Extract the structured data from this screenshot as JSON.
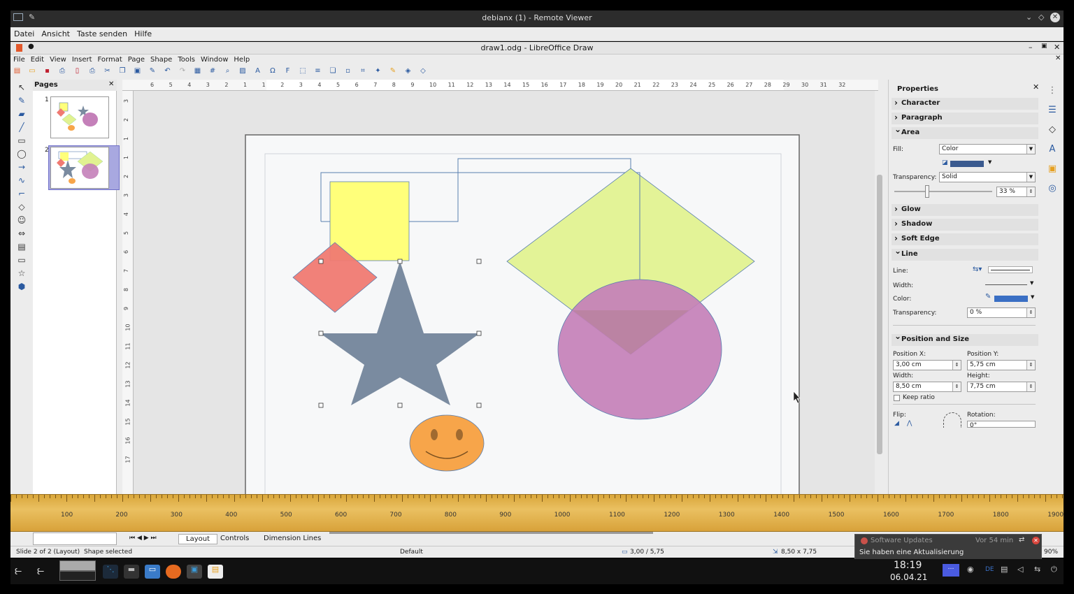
{
  "remote_viewer": {
    "title": "debianx (1) - Remote Viewer",
    "menu": [
      "Datei",
      "Ansicht",
      "Taste senden",
      "Hilfe"
    ]
  },
  "lo": {
    "title": "draw1.odg - LibreOffice Draw",
    "menu": [
      "File",
      "Edit",
      "View",
      "Insert",
      "Format",
      "Page",
      "Shape",
      "Tools",
      "Window",
      "Help"
    ]
  },
  "pages_pane": {
    "title": "Pages",
    "pages": [
      "1",
      "2"
    ],
    "selected": 1
  },
  "hruler_ticks": [
    "6",
    "5",
    "4",
    "3",
    "2",
    "1",
    "1",
    "2",
    "3",
    "4",
    "5",
    "6",
    "7",
    "8",
    "9",
    "10",
    "11",
    "12",
    "13",
    "14",
    "15",
    "16",
    "17",
    "18",
    "19",
    "20",
    "21",
    "22",
    "23",
    "24",
    "25",
    "26",
    "27",
    "28",
    "29",
    "30",
    "31",
    "32"
  ],
  "vruler_ticks": [
    "3",
    "2",
    "1",
    "1",
    "2",
    "3",
    "4",
    "5",
    "6",
    "7",
    "8",
    "9",
    "10",
    "11",
    "12",
    "13",
    "14",
    "15",
    "16",
    "17"
  ],
  "sidebar": {
    "title": "Properties",
    "sections": {
      "character": "Character",
      "paragraph": "Paragraph",
      "area": "Area",
      "glow": "Glow",
      "shadow": "Shadow",
      "soft_edge": "Soft Edge",
      "line": "Line",
      "position_size": "Position and Size"
    },
    "area": {
      "fill_label": "Fill:",
      "fill_value": "Color",
      "fill_color": "#3a5a8f",
      "transparency_label": "Transparency:",
      "transparency_mode": "Solid",
      "transparency_value": "33 %"
    },
    "line": {
      "line_label": "Line:",
      "width_label": "Width:",
      "color_label": "Color:",
      "color": "#3a6fc4",
      "transparency_label": "Transparency:",
      "transparency_value": "0 %"
    },
    "position": {
      "pos_x_label": "Position X:",
      "pos_x": "3,00 cm",
      "pos_y_label": "Position Y:",
      "pos_y": "5,75 cm",
      "width_label": "Width:",
      "width": "8,50 cm",
      "height_label": "Height:",
      "height": "7,75 cm",
      "keep_ratio": "Keep ratio",
      "flip_label": "Flip:",
      "rotation_label": "Rotation:",
      "rotation": "0°"
    }
  },
  "screen_ruler": [
    "100",
    "200",
    "300",
    "400",
    "500",
    "600",
    "700",
    "800",
    "900",
    "1000",
    "1100",
    "1200",
    "1300",
    "1400",
    "1500",
    "1600",
    "1700",
    "1800",
    "1900"
  ],
  "tabs": [
    "Layout",
    "Controls",
    "Dimension Lines"
  ],
  "active_tab": "Layout",
  "status": {
    "slide": "Slide 2 of 2 (Layout)",
    "selection": "Shape selected",
    "style": "Default",
    "position": "3,00 / 5,75",
    "size": "8,50 x 7,75",
    "zoom": "90%"
  },
  "notification": {
    "title": "Software Updates",
    "time": "Vor 54 min",
    "body": "Sie haben eine Aktualisierung"
  },
  "taskbar": {
    "time": "18:19",
    "date": "06.04.21",
    "lang": "DE"
  },
  "colors": {
    "yellow": "#ffff7a",
    "red": "#f07a72",
    "star": "#7a8ba0",
    "green": "#e1f291",
    "ellipse": "#c480b9",
    "smiley": "#f7a54a"
  }
}
